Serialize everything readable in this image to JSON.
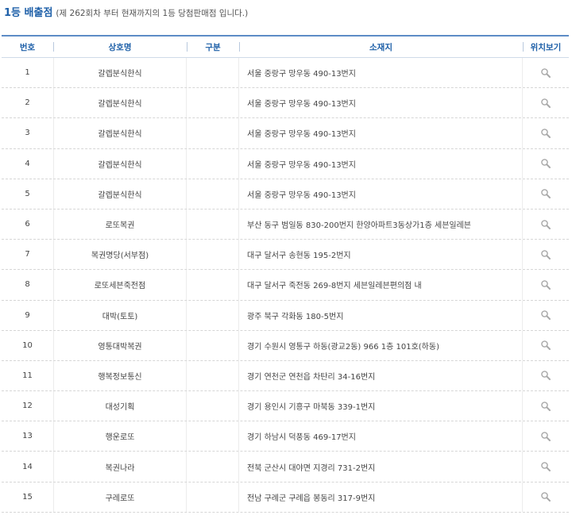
{
  "heading": {
    "title": "1등 배출점",
    "subtitle": "(제 262회차 부터 현재까지의 1등 당첨판매점 입니다.)"
  },
  "table": {
    "headers": [
      "번호",
      "상호명",
      "구분",
      "소재지",
      "위치보기"
    ],
    "rows": [
      {
        "no": "1",
        "name": "갈렙분식한식",
        "type": "",
        "address": "서울 중랑구 망우동 490-13번지"
      },
      {
        "no": "2",
        "name": "갈렙분식한식",
        "type": "",
        "address": "서울 중랑구 망우동 490-13번지"
      },
      {
        "no": "3",
        "name": "갈렙분식한식",
        "type": "",
        "address": "서울 중랑구 망우동 490-13번지"
      },
      {
        "no": "4",
        "name": "갈렙분식한식",
        "type": "",
        "address": "서울 중랑구 망우동 490-13번지"
      },
      {
        "no": "5",
        "name": "갈렙분식한식",
        "type": "",
        "address": "서울 중랑구 망우동 490-13번지"
      },
      {
        "no": "6",
        "name": "로또복권",
        "type": "",
        "address": "부산 동구 범일동 830-200번지 한양아파트3동상가1층 세븐일레븐"
      },
      {
        "no": "7",
        "name": "복권명당(서부점)",
        "type": "",
        "address": "대구 달서구 송현동 195-2번지"
      },
      {
        "no": "8",
        "name": "로또세븐죽전점",
        "type": "",
        "address": "대구 달서구 죽전동 269-8번지 세븐일레븐편의점 내"
      },
      {
        "no": "9",
        "name": "대박(토토)",
        "type": "",
        "address": "광주 북구 각화동 180-5번지"
      },
      {
        "no": "10",
        "name": "영통대박복권",
        "type": "",
        "address": "경기 수원시 영통구 하동(광교2동) 966 1층 101호(하동)"
      },
      {
        "no": "11",
        "name": "행복정보통신",
        "type": "",
        "address": "경기 연천군 연천읍 차탄리 34-16번지"
      },
      {
        "no": "12",
        "name": "대성기획",
        "type": "",
        "address": "경기 용인시 기흥구 마북동 339-1번지"
      },
      {
        "no": "13",
        "name": "행운로또",
        "type": "",
        "address": "경기 하남시 덕풍동 469-17번지"
      },
      {
        "no": "14",
        "name": "복권나라",
        "type": "",
        "address": "전북 군산시 대야면 지경리 731-2번지"
      },
      {
        "no": "15",
        "name": "구레로또",
        "type": "",
        "address": "전남 구례군 구례읍 봉동리 317-9번지"
      }
    ],
    "location_icon": "search-icon"
  },
  "colors": {
    "accent": "#1d5fa8",
    "header_border": "#5d8cc6"
  }
}
